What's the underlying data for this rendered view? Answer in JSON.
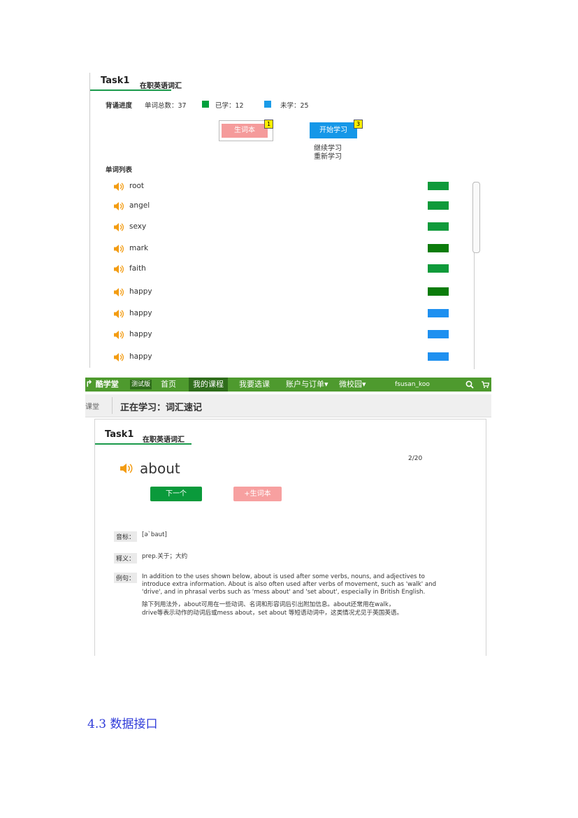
{
  "panel1": {
    "task_title": "Task1",
    "task_subtitle": "在职英语词汇",
    "progress_label": "背诵进度",
    "total_text": "单词总数：37",
    "learned_text": "已学：12",
    "unlearned_text": "未学：25",
    "learned_color": "#00a03c",
    "unlearned_color": "#1a9be8",
    "vocab_button": "生词本",
    "vocab_badge": "1",
    "start_button": "开始学习",
    "start_badge": "3",
    "start_menu": [
      "继续学习",
      "重新学习"
    ],
    "list_heading": "单词列表",
    "words": [
      {
        "word": "root",
        "color": "#0f9a3a"
      },
      {
        "word": "angel",
        "color": "#0f9a3a"
      },
      {
        "word": "sexy",
        "color": "#0f9a3a"
      },
      {
        "word": "mark",
        "color": "#0b7c0b"
      },
      {
        "word": "faith",
        "color": "#0f9a3a"
      },
      {
        "word": "happy",
        "color": "#0b7c0b"
      },
      {
        "word": "happy",
        "color": "#1e90f0"
      },
      {
        "word": "happy",
        "color": "#1e90f0"
      },
      {
        "word": "happy",
        "color": "#1e90f0"
      }
    ]
  },
  "panel2": {
    "nav": {
      "logo": "酷学堂",
      "tag": "测试版",
      "items": [
        "首页",
        "我的课程",
        "我要选课",
        "账户与订单▾",
        "微校园▾"
      ],
      "active_index": 1,
      "username": "fsusan_koo"
    },
    "breadcrumb_prev": "课堂",
    "page_title": "正在学习：词汇速记",
    "task_title": "Task1",
    "task_subtitle": "在职英语词汇",
    "word": "about",
    "counter": "2/20",
    "next_button": "下一个",
    "add_vocab_button": "+生词本",
    "phonetic_label": "音标：",
    "phonetic": "[ə`baut]",
    "meaning_label": "释义：",
    "meaning": "prep.关于；大约",
    "example_label": "例句：",
    "example_en": [
      "In addition to the uses shown below, about is used after some verbs, nouns, and adjectives to",
      "introduce extra information. About is also often used after verbs of movement, such as 'walk' and",
      "'drive', and in phrasal verbs such as 'mess about' and 'set about', especially in British English."
    ],
    "example_cn": [
      "除下列用法外，about可用在一些动词、名词和形容词后引出附加信息。about还常用在walk，",
      "drive等表示动作的动词后或mess about，set about 等短语动词中，这类情况尤见于英国英语。"
    ]
  },
  "section_heading": "4.3 数据接口"
}
